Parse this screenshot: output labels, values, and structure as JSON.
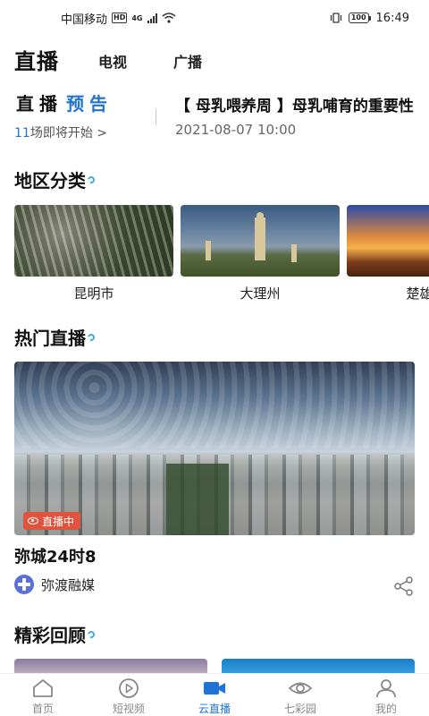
{
  "status_bar": {
    "carrier": "中国移动",
    "hd": "HD",
    "network": "4G",
    "battery": "100",
    "time": "16:49"
  },
  "top_tabs": {
    "main": "直播",
    "tv": "电视",
    "radio": "广播"
  },
  "preview": {
    "title_a": "直播",
    "title_b": "预告",
    "count": "11",
    "count_suffix": "场即将开始 >",
    "event_title": "【 母乳喂养周 】母乳哺育的重要性",
    "event_time": "2021-08-07 10:00"
  },
  "regions": {
    "title": "地区分类",
    "items": [
      {
        "label": "昆明市"
      },
      {
        "label": "大理州"
      },
      {
        "label": "楚雄州"
      }
    ]
  },
  "hot_live": {
    "title": "热门直播",
    "badge": "直播中",
    "card_title": "弥城24时8",
    "source": "弥渡融媒"
  },
  "review": {
    "title": "精彩回顾"
  },
  "bottom_nav": {
    "items": [
      {
        "label": "首页",
        "icon": "home-icon",
        "active": false
      },
      {
        "label": "短视频",
        "icon": "play-circle-icon",
        "active": false
      },
      {
        "label": "云直播",
        "icon": "video-camera-icon",
        "active": true
      },
      {
        "label": "七彩园",
        "icon": "eye-icon",
        "active": false
      },
      {
        "label": "我的",
        "icon": "user-icon",
        "active": false
      }
    ]
  },
  "colors": {
    "accent": "#1e73d4",
    "live_badge": "#e0543e"
  }
}
